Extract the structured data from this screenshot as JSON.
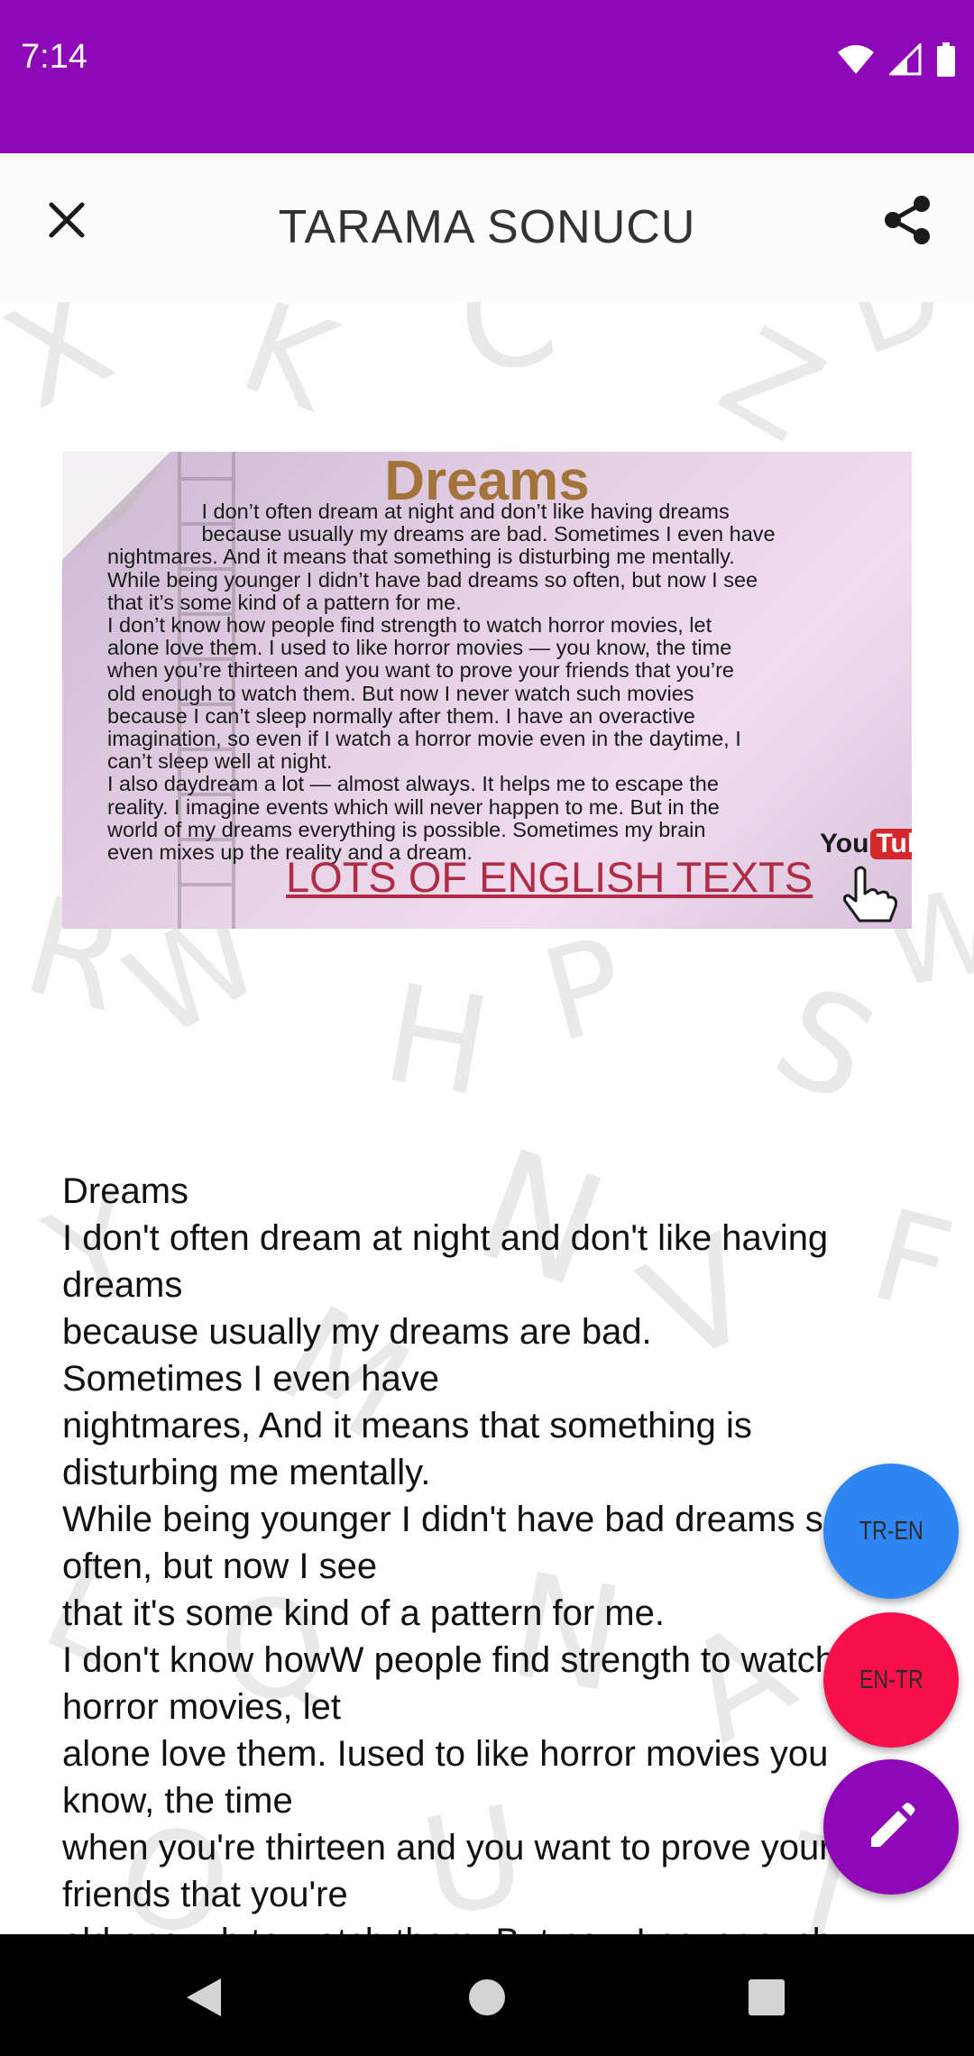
{
  "status": {
    "time": "7:14"
  },
  "header": {
    "title": "TARAMA SONUCU"
  },
  "scan_image": {
    "title": "Dreams",
    "lines": [
      "                I don’t often dream at night and don’t like having dreams",
      "                because usually my dreams are bad. Sometimes I even have",
      "nightmares. And it means that something is disturbing me mentally.",
      "While being younger I didn’t have bad dreams so often, but now I see",
      "that it’s some kind of a pattern for me.",
      "I don’t know how people find strength to watch horror movies, let",
      "alone love them. I used to like horror movies — you know, the time",
      "when you’re thirteen and you want to prove your friends that you’re",
      "old enough to watch them. But now I never watch such movies",
      "because I can’t sleep normally after them. I have an overactive",
      "imagination, so even if I watch a horror movie even in the daytime, I",
      "can’t sleep well at night.",
      "I also daydream a lot — almost always. It helps me to escape the",
      "reality. I imagine events which will never happen to me. But in the",
      "world of my dreams everything is possible. Sometimes my brain",
      "even mixes up the reality and a dream."
    ],
    "footer": "LOTS OF ENGLISH TEXTS",
    "badge_you": "You",
    "badge_tube": "Tube"
  },
  "result_lines": [
    "Dreams",
    "I don't often dream at night and don't like having",
    "dreams",
    "because usually my dreams are bad.",
    "Sometimes I even have",
    "nightmares, And it means that something is",
    "disturbing me mentally.",
    "While being younger I didn't have bad dreams so",
    "often, but now I see",
    "that it's some kind of a pattern for me.",
    "I don't know howW people find strength to watch",
    "horror movies, let",
    "alone love them. Iused to like horror movies you",
    "know, the time",
    "when you're thirteen and you want to prove your",
    "friends that you're",
    "old enough to watch them. But now I never such"
  ],
  "fabs": {
    "tr_en": "TR-EN",
    "en_tr": "EN-TR"
  },
  "colors": {
    "accent": "#8e08b8",
    "tr_en_fab": "#2e86f5",
    "en_tr_fab": "#f8104a"
  }
}
